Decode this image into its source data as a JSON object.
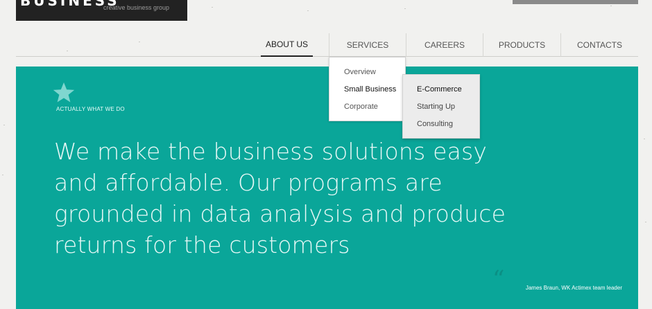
{
  "header": {
    "logo_name": "BUSINESS",
    "logo_tagline": "creative business group"
  },
  "nav": {
    "items": [
      {
        "label": "ABOUT US"
      },
      {
        "label": "SERVICES"
      },
      {
        "label": "CAREERS"
      },
      {
        "label": "PRODUCTS"
      },
      {
        "label": "CONTACTS"
      }
    ]
  },
  "services_menu": {
    "items": [
      {
        "label": "Overview"
      },
      {
        "label": "Small Business"
      },
      {
        "label": "Corporate"
      }
    ]
  },
  "small_business_submenu": {
    "items": [
      {
        "label": "E-Commerce"
      },
      {
        "label": "Starting Up"
      },
      {
        "label": "Consulting"
      }
    ]
  },
  "hero": {
    "eyebrow": "ACTUALLY WHAT WE DO",
    "headline": "We make the business solutions easy and affordable. Our programs are grounded in data analysis and produce returns for the customers",
    "quote_mark": "“",
    "quote_author": "James Braun, WK Actimex team leader",
    "background_color": "#0aa699"
  },
  "icons": {
    "star": "star-icon",
    "quote": "quote-icon"
  }
}
